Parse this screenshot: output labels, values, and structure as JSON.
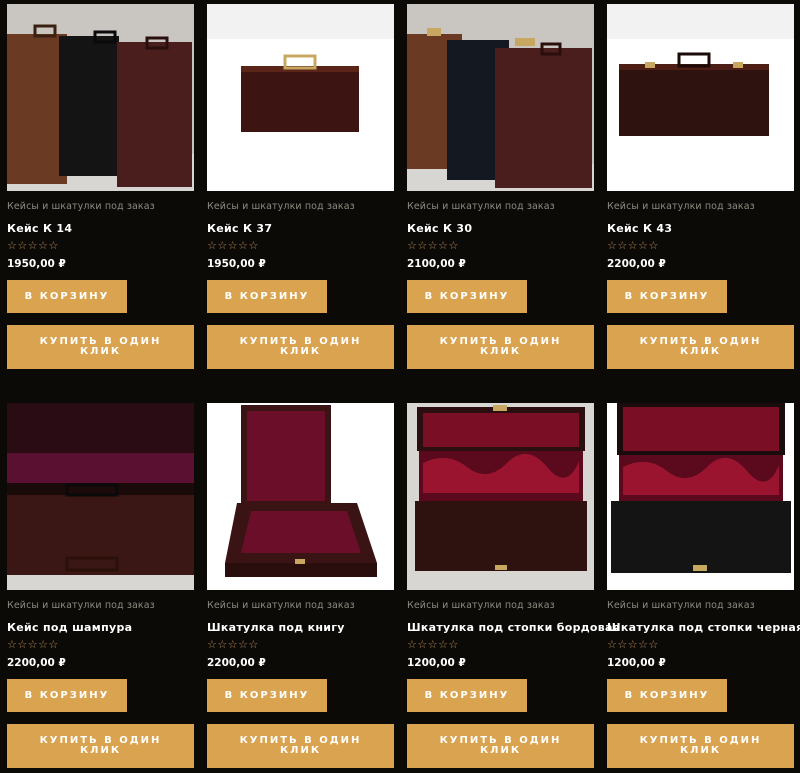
{
  "products": [
    {
      "category": "Кейсы и шкатулки под заказ",
      "name": "Кейс К 14",
      "rating": "☆☆☆☆☆",
      "price": "1950,00 ₽",
      "cart_label": "В КОРЗИНУ",
      "oneclick_label": "КУПИТЬ В ОДИН КЛИК"
    },
    {
      "category": "Кейсы и шкатулки под заказ",
      "name": "Кейс К 37",
      "rating": "☆☆☆☆☆",
      "price": "1950,00 ₽",
      "cart_label": "В КОРЗИНУ",
      "oneclick_label": "КУПИТЬ В ОДИН КЛИК"
    },
    {
      "category": "Кейсы и шкатулки под заказ",
      "name": "Кейс К 30",
      "rating": "☆☆☆☆☆",
      "price": "2100,00 ₽",
      "cart_label": "В КОРЗИНУ",
      "oneclick_label": "КУПИТЬ В ОДИН КЛИК"
    },
    {
      "category": "Кейсы и шкатулки под заказ",
      "name": "Кейс К 43",
      "rating": "☆☆☆☆☆",
      "price": "2200,00 ₽",
      "cart_label": "В КОРЗИНУ",
      "oneclick_label": "КУПИТЬ В ОДИН КЛИК"
    },
    {
      "category": "Кейсы и шкатулки под заказ",
      "name": "Кейс под шампура",
      "rating": "☆☆☆☆☆",
      "price": "2200,00 ₽",
      "cart_label": "В КОРЗИНУ",
      "oneclick_label": "КУПИТЬ В ОДИН КЛИК"
    },
    {
      "category": "Кейсы и шкатулки под заказ",
      "name": "Шкатулка под книгу",
      "rating": "☆☆☆☆☆",
      "price": "2200,00 ₽",
      "cart_label": "В КОРЗИНУ",
      "oneclick_label": "КУПИТЬ В ОДИН КЛИК"
    },
    {
      "category": "Кейсы и шкатулки под заказ",
      "name": "Шкатулка под стопки бордовая",
      "rating": "☆☆☆☆☆",
      "price": "1200,00 ₽",
      "cart_label": "В КОРЗИНУ",
      "oneclick_label": "КУПИТЬ В ОДИН КЛИК"
    },
    {
      "category": "Кейсы и шкатулки под заказ",
      "name": "Шкатулка под стопки черная",
      "rating": "☆☆☆☆☆",
      "price": "1200,00 ₽",
      "cart_label": "В КОРЗИНУ",
      "oneclick_label": "КУПИТЬ В ОДИН КЛИК"
    }
  ],
  "colors": {
    "background": "#0b0a07",
    "button": "#d9a34f",
    "category_text": "#8e8a80",
    "star": "#b88a5a"
  }
}
